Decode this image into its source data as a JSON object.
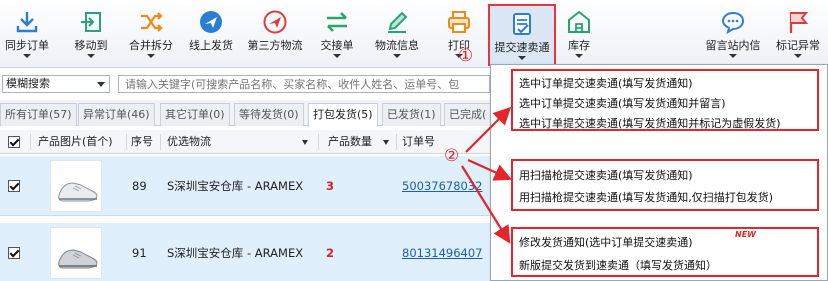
{
  "toolbar": {
    "items": [
      {
        "label": "同步订单",
        "icon": "download-icon"
      },
      {
        "label": "移动到",
        "icon": "move-to-icon"
      },
      {
        "label": "合并拆分",
        "icon": "shuffle-icon"
      },
      {
        "label": "线上发货",
        "icon": "plane-icon"
      },
      {
        "label": "第三方物流",
        "icon": "plane-circle-icon"
      },
      {
        "label": "交接单",
        "icon": "swap-arrows-icon"
      },
      {
        "label": "物流信息",
        "icon": "pencil-icon"
      },
      {
        "label": "打印",
        "icon": "printer-icon"
      },
      {
        "label": "提交速卖通",
        "icon": "document-check-icon"
      },
      {
        "label": "库存",
        "icon": "warehouse-icon"
      },
      {
        "label": "留言站内信",
        "icon": "chat-bubble-icon"
      },
      {
        "label": "标记异常",
        "icon": "flag-icon"
      }
    ]
  },
  "search": {
    "mode_value": "模糊搜索",
    "placeholder": "请输入关键字(可搜索产品名称、买家名称、收件人姓名、运单号、包"
  },
  "tabs": [
    "所有订单(57)",
    "异常订单(46)",
    "其它订单(0)",
    "等待发货(0)",
    "打包发货(5)",
    "已发货(1)",
    "已完成("
  ],
  "table": {
    "headers": {
      "image": "产品图片(首个)",
      "seq": "序号",
      "logistics": "优选物流",
      "qty": "产品数量",
      "order_no": "订单号"
    },
    "rows": [
      {
        "seq": "89",
        "logistics": "S深圳宝安仓库 - ARAMEX",
        "qty": "3",
        "order_no": "50037678032"
      },
      {
        "seq": "91",
        "logistics": "S深圳宝安仓库 - ARAMEX",
        "qty": "2",
        "order_no": "80131496407"
      }
    ]
  },
  "menu": {
    "group1": [
      "选中订单提交速卖通(填写发货通知)",
      "选中订单提交速卖通(填写发货通知并留言)",
      "选中订单提交速卖通(填写发货通知并标记为虚假发货)"
    ],
    "group2": [
      "用扫描枪提交速卖通(填写发货通知)",
      "用扫描枪提交速卖通(填写发货通知,仅扫描打包发货)"
    ],
    "group3": [
      "修改发货通知(选中订单提交速卖通)",
      "新版提交发货到速卖通（填写发货通知）"
    ],
    "new_badge": "NEW"
  },
  "annotations": {
    "marker1": "①",
    "marker2": "②"
  },
  "colors": {
    "accent_red": "#e2262b",
    "row_bg": "#dfeffb",
    "link_blue": "#1a5fb4"
  }
}
